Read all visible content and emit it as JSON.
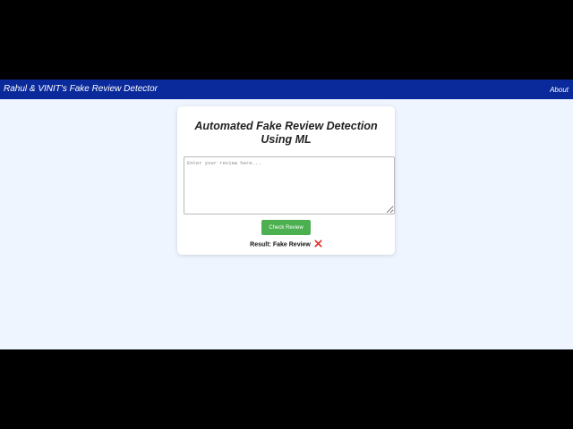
{
  "navbar": {
    "brand": "Rahul & VINIT's Fake Review Detector",
    "about_label": "About"
  },
  "card": {
    "title_line1": "Automated Fake Review Detection",
    "title_line2": "Using ML",
    "input": {
      "placeholder": "Enter your review here...",
      "value": ""
    },
    "check_button_label": "Check Review",
    "result": {
      "label": "Result:",
      "value": "Fake Review",
      "icon": "x-icon"
    }
  },
  "colors": {
    "navbar": "#0a2a9c",
    "page_background": "#eef5ff",
    "button": "#4caf50",
    "x_icon": "#e53935",
    "letterbox": "#000000"
  }
}
